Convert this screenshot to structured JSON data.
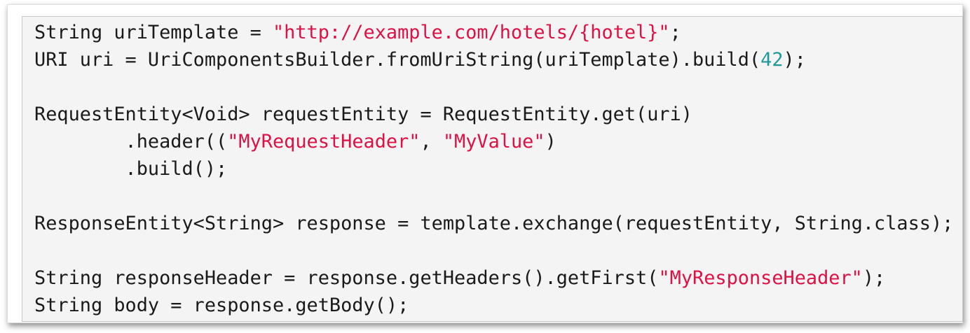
{
  "code_block": {
    "colors": {
      "string": "#dd1144",
      "number": "#1e9a9a",
      "text": "#1a1a1a",
      "background": "#f4f4f4"
    },
    "lines": [
      [
        {
          "t": "String uriTemplate = "
        },
        {
          "t": "\"http://example.com/hotels/{hotel}\"",
          "k": "str"
        },
        {
          "t": ";"
        }
      ],
      [
        {
          "t": "URI uri = UriComponentsBuilder.fromUriString(uriTemplate).build("
        },
        {
          "t": "42",
          "k": "num"
        },
        {
          "t": ");"
        }
      ],
      [],
      [
        {
          "t": "RequestEntity<Void> requestEntity = RequestEntity.get(uri)"
        }
      ],
      [
        {
          "t": "        .header(("
        },
        {
          "t": "\"MyRequestHeader\"",
          "k": "str"
        },
        {
          "t": ", "
        },
        {
          "t": "\"MyValue\"",
          "k": "str"
        },
        {
          "t": ")"
        }
      ],
      [
        {
          "t": "        .build();"
        }
      ],
      [],
      [
        {
          "t": "ResponseEntity<String> response = template.exchange(requestEntity, String.class);"
        }
      ],
      [],
      [
        {
          "t": "String responseHeader = response.getHeaders().getFirst("
        },
        {
          "t": "\"MyResponseHeader\"",
          "k": "str"
        },
        {
          "t": ");"
        }
      ],
      [
        {
          "t": "String body = response.getBody();"
        }
      ]
    ]
  }
}
